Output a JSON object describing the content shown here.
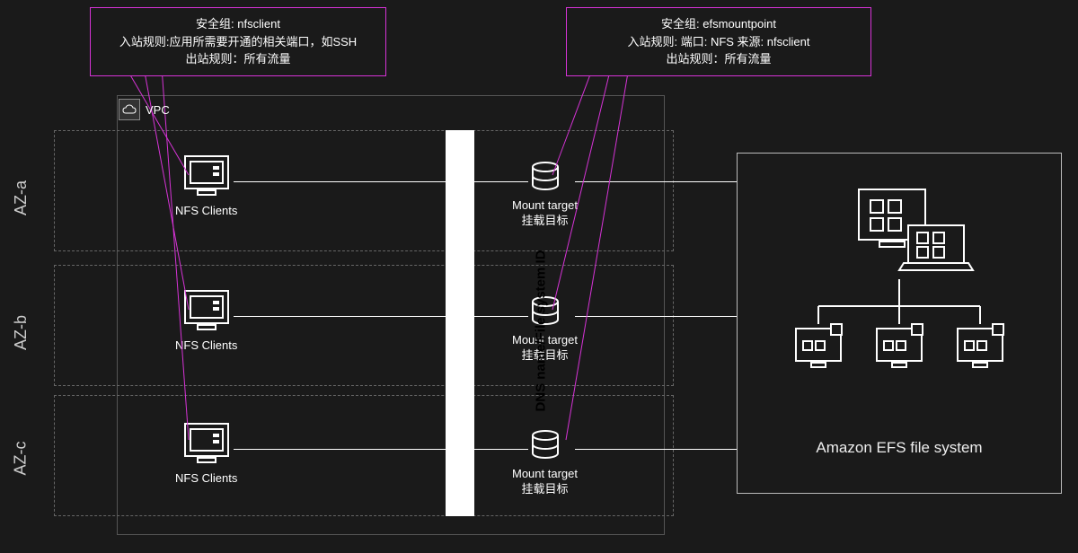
{
  "callouts": {
    "left": {
      "line1": "安全组: nfsclient",
      "line2": "入站规则:应用所需要开通的相关端口，如SSH",
      "line3": "出站规则：所有流量"
    },
    "right": {
      "line1": "安全组: efsmountpoint",
      "line2": "入站规则: 端口: NFS 来源: nfsclient",
      "line3": "出站规则：所有流量"
    }
  },
  "vpc_label": "VPC",
  "az_labels": {
    "a": "AZ-a",
    "b": "AZ-b",
    "c": "AZ-c"
  },
  "nfs_label": "NFS Clients",
  "mount_target": {
    "line1": "Mount target",
    "line2": "挂载目标"
  },
  "dns_label": "DNS name/File system ID",
  "efs_title": "Amazon EFS file system"
}
